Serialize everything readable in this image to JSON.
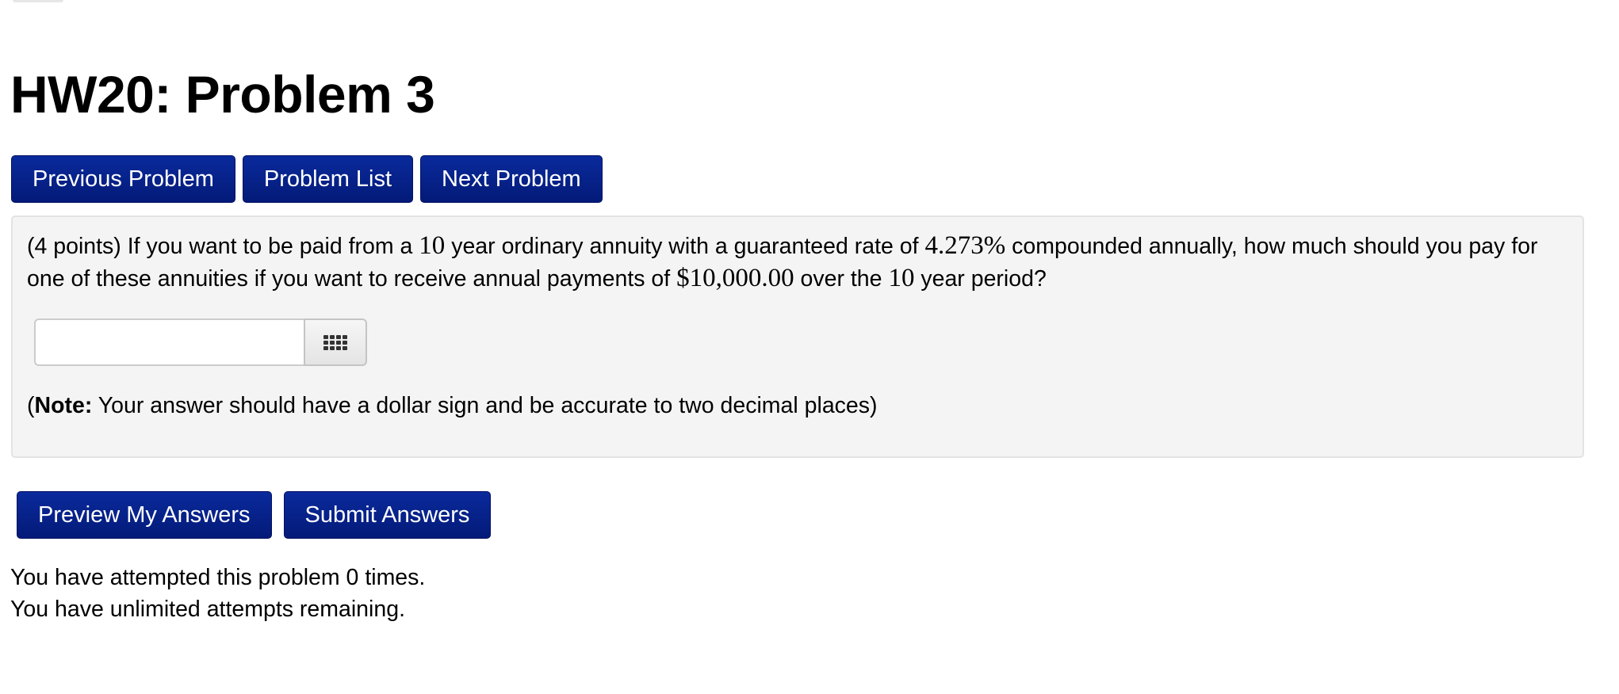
{
  "header": {
    "title": "HW20: Problem 3"
  },
  "nav": {
    "previous_label": "Previous Problem",
    "list_label": "Problem List",
    "next_label": "Next Problem"
  },
  "problem": {
    "points": "(4 points)",
    "text_1": "If you want to be paid from a",
    "years": "10",
    "text_2": "year ordinary annuity with a guaranteed rate of",
    "rate": "4.273%",
    "text_3": "compounded annually, how much should you pay for one of these annuities if you want to receive annual payments of",
    "payment": "$10,000.00",
    "text_4": "over the",
    "period_years": "10",
    "text_5": "year period?",
    "answer_value": "",
    "keypad_icon": "keypad-icon",
    "note_open": "(",
    "note_label": "Note:",
    "note_text": "Your answer should have a dollar sign and be accurate to two decimal places)"
  },
  "actions": {
    "preview_label": "Preview My Answers",
    "submit_label": "Submit Answers"
  },
  "status": {
    "attempts_line": "You have attempted this problem 0 times.",
    "remaining_line": "You have unlimited attempts remaining."
  },
  "colors": {
    "button_bg": "#031a78",
    "button_text": "#ffffff",
    "problem_bg": "#f4f4f4"
  }
}
